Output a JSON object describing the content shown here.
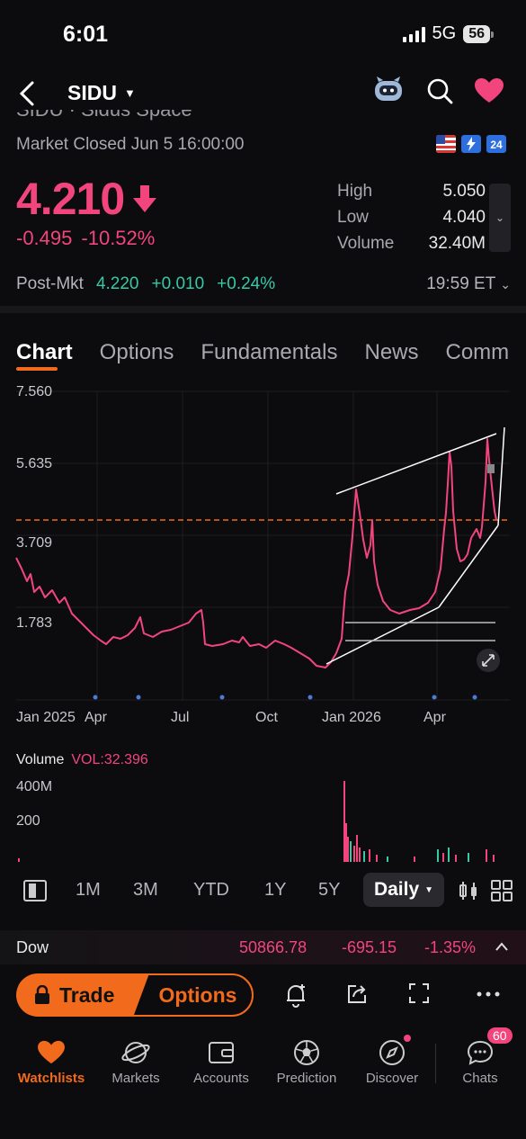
{
  "status": {
    "time": "6:01",
    "network": "5G",
    "battery": "56"
  },
  "nav": {
    "ticker": "SIDU",
    "company_name_partial": "SIDU · Sidus Space"
  },
  "quote": {
    "market_status": "Market Closed Jun 5 16:00:00",
    "price": "4.210",
    "change": "-0.495",
    "change_pct": "-10.52%",
    "high_label": "High",
    "high": "5.050",
    "low_label": "Low",
    "low": "4.040",
    "volume_label": "Volume",
    "volume": "32.40M",
    "post_label": "Post-Mkt",
    "post_price": "4.220",
    "post_change": "+0.010",
    "post_pct": "+0.24%",
    "post_time": "19:59 ET"
  },
  "tabs": [
    "Chart",
    "Options",
    "Fundamentals",
    "News",
    "Comm"
  ],
  "chart": {
    "y_labels": [
      "7.560",
      "5.635",
      "3.709",
      "1.783"
    ],
    "x_labels": [
      "Jan 2025",
      "Apr",
      "Jul",
      "Oct",
      "Jan 2026",
      "Apr"
    ],
    "volume_title": "Volume",
    "volume_value": "VOL:32.396",
    "volume_labels": [
      "400M",
      "200"
    ]
  },
  "chart_data": {
    "type": "line",
    "ylim": [
      0.9,
      7.56
    ],
    "last_price_line": 4.21,
    "x": [
      "2025-01",
      "2025-02",
      "2025-03",
      "2025-04",
      "2025-05",
      "2025-06",
      "2025-07",
      "2025-08",
      "2025-09",
      "2025-10",
      "2025-11",
      "2025-12",
      "2025-12-20",
      "2026-01",
      "2026-01-15",
      "2026-02",
      "2026-03",
      "2026-04",
      "2026-04-20",
      "2026-05",
      "2026-05-20",
      "2026-06"
    ],
    "values": [
      3.3,
      2.9,
      2.3,
      1.5,
      1.7,
      1.9,
      2.1,
      1.3,
      1.3,
      1.3,
      1.1,
      0.9,
      1.7,
      4.8,
      3.2,
      2.2,
      2.0,
      2.8,
      6.6,
      3.5,
      6.5,
      4.21
    ]
  },
  "periods": [
    "1M",
    "3M",
    "YTD",
    "1Y",
    "5Y"
  ],
  "period_selected": "Daily",
  "index": {
    "name": "Dow",
    "value": "50866.78",
    "change": "-695.15",
    "pct": "-1.35%"
  },
  "actions": {
    "trade": "Trade",
    "options": "Options"
  },
  "tabbar": [
    {
      "label": "Watchlists",
      "icon": "heart-icon"
    },
    {
      "label": "Markets",
      "icon": "planet-icon"
    },
    {
      "label": "Accounts",
      "icon": "wallet-icon"
    },
    {
      "label": "Prediction",
      "icon": "soccer-ball-icon"
    },
    {
      "label": "Discover",
      "icon": "compass-icon"
    },
    {
      "label": "Chats",
      "icon": "chat-icon",
      "badge": "60"
    }
  ],
  "colors": {
    "accent": "#f26a1b",
    "down": "#f2457d",
    "up": "#37c8a8"
  }
}
